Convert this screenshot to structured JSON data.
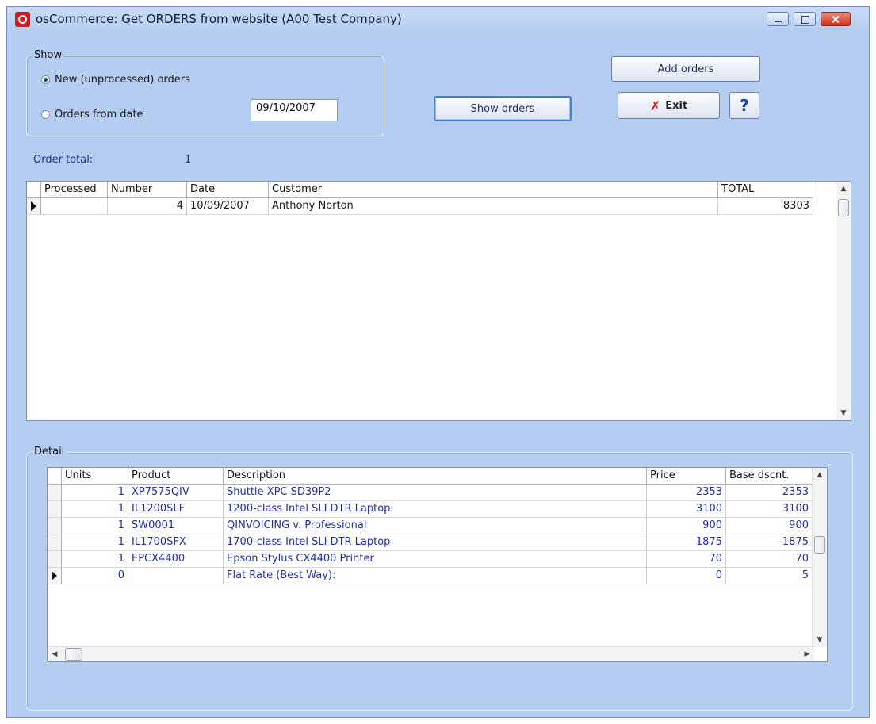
{
  "window": {
    "title": "osCommerce: Get ORDERS from website (A00 Test Company)",
    "app_icon": "q-app-icon",
    "controls": [
      "minimize-icon",
      "maximize-icon",
      "close-icon"
    ]
  },
  "show_group": {
    "legend": "Show",
    "option_new": "New (unprocessed) orders",
    "option_from_date": "Orders from date",
    "date_value": "09/10/2007",
    "selected": "new"
  },
  "buttons": {
    "show_orders": "Show orders",
    "add_orders": "Add orders",
    "exit": "Exit",
    "exit_icon": "✗",
    "help_icon": "?"
  },
  "order_total": {
    "label": "Order total:",
    "value": "1"
  },
  "orders_grid": {
    "columns": [
      "Processed",
      "Number",
      "Date",
      "Customer",
      "TOTAL"
    ],
    "rows": [
      {
        "processed": "",
        "number": "4",
        "date": "10/09/2007",
        "customer": "Anthony Norton",
        "total": "8303"
      }
    ]
  },
  "detail": {
    "legend": "Detail",
    "columns": [
      "Units",
      "Product",
      "Description",
      "Price",
      "Base dscnt."
    ],
    "rows": [
      {
        "units": "1",
        "product": "XP7575QIV",
        "description": "Shuttle XPC SD39P2",
        "price": "2353",
        "base": "2353"
      },
      {
        "units": "1",
        "product": "IL1200SLF",
        "description": "1200-class Intel SLI DTR Laptop",
        "price": "3100",
        "base": "3100"
      },
      {
        "units": "1",
        "product": "SW0001",
        "description": "QINVOICING v. Professional",
        "price": "900",
        "base": "900"
      },
      {
        "units": "1",
        "product": "IL1700SFX",
        "description": "1700-class Intel SLI DTR Laptop",
        "price": "1875",
        "base": "1875"
      },
      {
        "units": "1",
        "product": "EPCX4400",
        "description": "Epson Stylus CX4400 Printer",
        "price": "70",
        "base": "70"
      },
      {
        "units": "0",
        "product": "",
        "description": "Flat Rate (Best Way):",
        "price": "0",
        "base": "5"
      }
    ]
  },
  "colors": {
    "window_bg": "#b6cdf2",
    "label_blue": "#1e2f80",
    "exit_red": "#cc1b12",
    "help_blue": "#1d46a8"
  }
}
